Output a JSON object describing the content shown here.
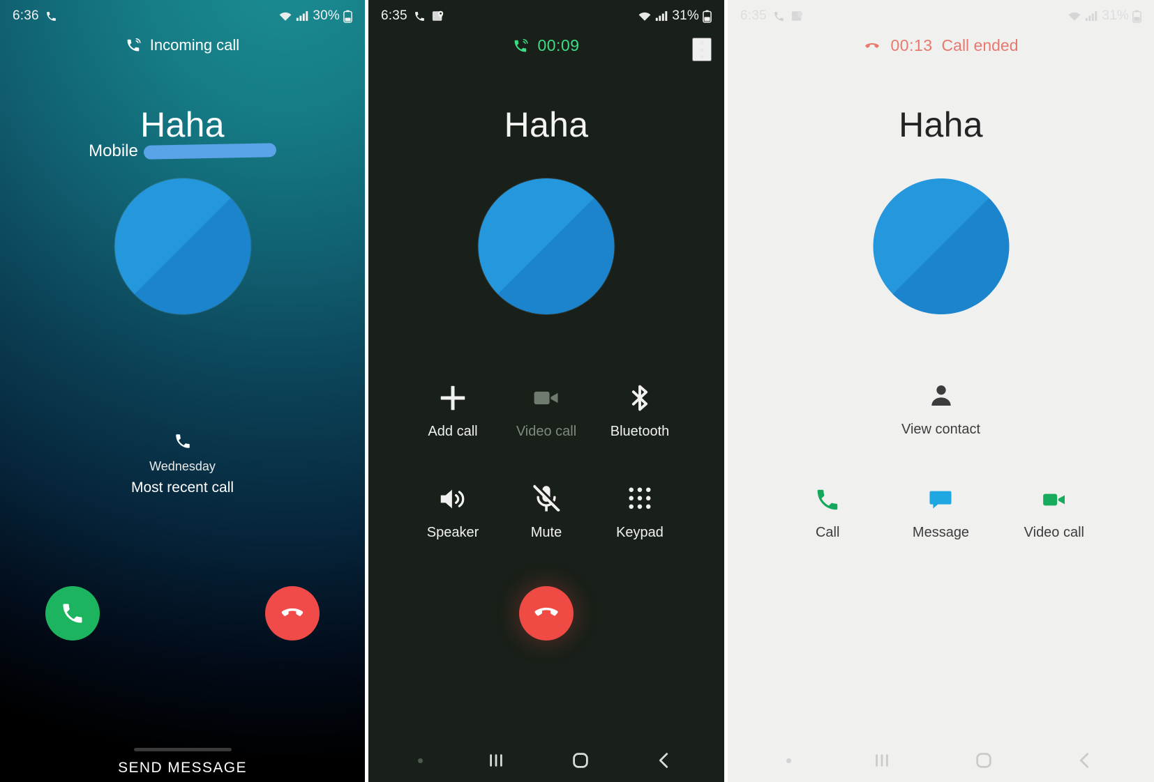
{
  "meta": {
    "accent_green": "#1cb45e",
    "accent_red": "#f04a49",
    "avatar_blue": "#2497dd",
    "timer_green": "#3ddc84",
    "ended_red": "#e8796f",
    "panel2_bg": "#182019",
    "panel3_bg": "#f0f0ef"
  },
  "panel_incoming": {
    "status": {
      "time": "6:36",
      "phone_icon": "phone-icon",
      "wifi_icon": "wifi-icon",
      "signal_icon": "signal-bars-icon",
      "battery_pct": "30%",
      "battery_icon": "battery-icon"
    },
    "header": {
      "icon": "phone-incoming-icon",
      "label": "Incoming call"
    },
    "contact": {
      "name": "Haha",
      "line_label": "Mobile",
      "number_redacted": "redacted-phone-number"
    },
    "avatar": "contact-avatar",
    "recent": {
      "icon": "phone-icon",
      "day": "Wednesday",
      "text": "Most recent call"
    },
    "answer_button": "answer-call",
    "decline_button": "decline-call",
    "send_message": "SEND MESSAGE"
  },
  "panel_active": {
    "status": {
      "time": "6:35",
      "phone_icon": "phone-icon",
      "maps_icon": "maps-location-icon",
      "wifi_icon": "wifi-icon",
      "signal_icon": "signal-bars-icon",
      "battery_pct": "31%",
      "battery_icon": "battery-icon"
    },
    "header": {
      "icon": "phone-active-icon",
      "timer": "00:09"
    },
    "overflow": "more-options",
    "contact": {
      "name": "Haha"
    },
    "avatar": "contact-avatar",
    "controls": [
      {
        "icon": "plus-icon",
        "label": "Add call",
        "disabled": false
      },
      {
        "icon": "video-cam-icon",
        "label": "Video call",
        "disabled": true
      },
      {
        "icon": "bluetooth-icon",
        "label": "Bluetooth",
        "disabled": false
      },
      {
        "icon": "speaker-icon",
        "label": "Speaker",
        "disabled": false
      },
      {
        "icon": "mic-off-icon",
        "label": "Mute",
        "disabled": false
      },
      {
        "icon": "keypad-icon",
        "label": "Keypad",
        "disabled": false
      }
    ],
    "end_call_button": "end-call",
    "nav": {
      "recents": "recents-nav",
      "home": "home-nav",
      "back": "back-nav",
      "dot": "nav-dot"
    }
  },
  "panel_ended": {
    "status": {
      "time": "6:35",
      "battery_pct": "31%"
    },
    "header": {
      "icon": "phone-ended-icon",
      "timer": "00:13",
      "label": "Call ended"
    },
    "contact": {
      "name": "Haha"
    },
    "avatar": "contact-avatar",
    "view_contact": {
      "icon": "person-icon",
      "label": "View contact"
    },
    "actions": [
      {
        "icon": "phone-icon",
        "label": "Call",
        "color": "#15a85c"
      },
      {
        "icon": "message-icon",
        "label": "Message",
        "color": "#1ea7e1"
      },
      {
        "icon": "video-cam-icon",
        "label": "Video call",
        "color": "#16ab5d"
      }
    ],
    "nav": {
      "recents": "recents-nav",
      "home": "home-nav",
      "back": "back-nav",
      "dot": "nav-dot"
    }
  }
}
